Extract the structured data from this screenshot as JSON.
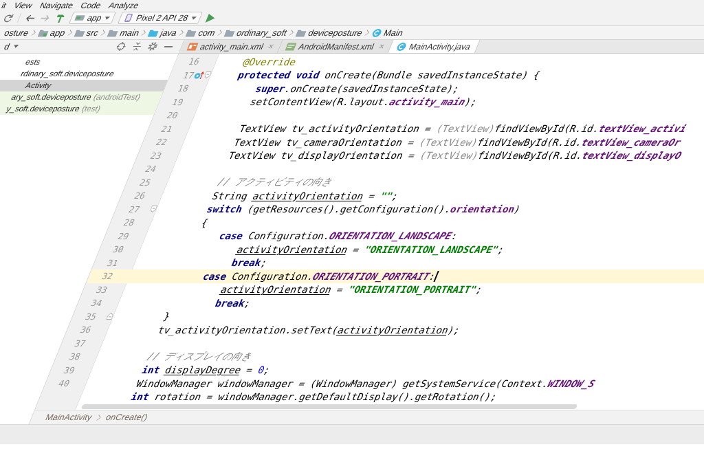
{
  "menu_bar": {
    "items": [
      "it",
      "View",
      "Navigate",
      "Code",
      "Analyze"
    ]
  },
  "toolbar": {
    "configuration": "app",
    "device": "Pixel 2 API 28"
  },
  "navigation_bar": {
    "items": [
      {
        "label": "osture",
        "kind": "plain"
      },
      {
        "label": "app",
        "kind": "module"
      },
      {
        "label": "src",
        "kind": "folder"
      },
      {
        "label": "main",
        "kind": "folder"
      },
      {
        "label": "java",
        "kind": "source"
      },
      {
        "label": "com",
        "kind": "package"
      },
      {
        "label": "ordinary_soft",
        "kind": "package"
      },
      {
        "label": "deviceposture",
        "kind": "package"
      },
      {
        "label": "Main",
        "kind": "class"
      }
    ]
  },
  "project": {
    "view_selector": "d",
    "tree": [
      {
        "label": "ests",
        "kind": "main",
        "selected": false
      },
      {
        "label": "rdinary_soft.deviceposture",
        "kind": "main",
        "selected": false,
        "children": [
          {
            "label": "Activity",
            "kind": "main",
            "selected": true
          }
        ]
      },
      {
        "label": "ary_soft.deviceposture",
        "suffix": "(androidTest)",
        "kind": "test",
        "selected": false
      },
      {
        "label": "y_soft.deviceposture",
        "suffix": "(test)",
        "kind": "test",
        "selected": false
      }
    ]
  },
  "editor_tabs": [
    {
      "label": "activity_main.xml",
      "kind": "layout",
      "selected": false,
      "close_button": true
    },
    {
      "label": "AndroidManifest.xml",
      "kind": "manifest",
      "selected": false,
      "close_button": true
    },
    {
      "label": "MainActivity.java",
      "kind": "class",
      "selected": true,
      "close_button": false
    }
  ],
  "editor": {
    "lines": [
      {
        "number": "16",
        "current": false,
        "tokens": [
          {
            "kind": "annotation",
            "text": "    @Override"
          }
        ]
      },
      {
        "number": "17",
        "current": false,
        "gutter_icons": [
          {
            "kind": "override"
          },
          {
            "kind": "fold_start"
          }
        ],
        "tokens": [
          {
            "kind": "keyword",
            "text": "    protected void"
          },
          {
            "kind": "plain",
            "text": " onCreate(Bundle savedInstanceState) {"
          }
        ]
      },
      {
        "number": "18",
        "current": false,
        "tokens": [
          {
            "kind": "keyword",
            "text": "        super"
          },
          {
            "kind": "plain",
            "text": ".onCreate(savedInstanceState);"
          }
        ]
      },
      {
        "number": "19",
        "current": false,
        "tokens": [
          {
            "kind": "plain",
            "text": "        setContentView(R.layout."
          },
          {
            "kind": "static_field",
            "text": "activity_main"
          },
          {
            "kind": "plain",
            "text": ");"
          }
        ]
      },
      {
        "number": "20",
        "current": false
      },
      {
        "number": "21",
        "current": false,
        "tokens": [
          {
            "kind": "plain",
            "text": "        TextView tv_activityOrientation = "
          },
          {
            "kind": "redundant",
            "text": "(TextView)"
          },
          {
            "kind": "plain",
            "text": "findViewById(R.id."
          },
          {
            "kind": "static_field",
            "text": "textView_activi"
          }
        ]
      },
      {
        "number": "22",
        "current": false,
        "tokens": [
          {
            "kind": "plain",
            "text": "        TextView tv_cameraOrientation = "
          },
          {
            "kind": "redundant",
            "text": "(TextView)"
          },
          {
            "kind": "plain",
            "text": "findViewById(R.id."
          },
          {
            "kind": "static_field",
            "text": "textView_cameraOr"
          }
        ]
      },
      {
        "number": "23",
        "current": false,
        "tokens": [
          {
            "kind": "plain",
            "text": "        TextView tv_displayOrientation = "
          },
          {
            "kind": "redundant",
            "text": "(TextView)"
          },
          {
            "kind": "plain",
            "text": "findViewById(R.id."
          },
          {
            "kind": "static_field",
            "text": "textView_displayO"
          }
        ]
      },
      {
        "number": "24",
        "current": false
      },
      {
        "number": "25",
        "current": false,
        "tokens": [
          {
            "kind": "comment",
            "text": "        // アクティビティの向き"
          }
        ]
      },
      {
        "number": "26",
        "current": false,
        "tokens": [
          {
            "kind": "plain",
            "text": "        String "
          },
          {
            "kind": "reassigned",
            "text": "activityOrientation"
          },
          {
            "kind": "plain",
            "text": " = "
          },
          {
            "kind": "string",
            "text": "\"\""
          },
          {
            "kind": "plain",
            "text": ";"
          }
        ]
      },
      {
        "number": "27",
        "current": false,
        "gutter_icons": [
          {
            "kind": "fold_start"
          }
        ],
        "tokens": [
          {
            "kind": "keyword",
            "text": "        switch"
          },
          {
            "kind": "plain",
            "text": " (getResources().getConfiguration()."
          },
          {
            "kind": "field",
            "text": "orientation"
          },
          {
            "kind": "plain",
            "text": ")"
          }
        ]
      },
      {
        "number": "28",
        "current": false,
        "tokens": [
          {
            "kind": "plain",
            "text": "        {"
          }
        ]
      },
      {
        "number": "29",
        "current": false,
        "tokens": [
          {
            "kind": "keyword",
            "text": "            case"
          },
          {
            "kind": "plain",
            "text": " Configuration."
          },
          {
            "kind": "static_field",
            "text": "ORIENTATION_LANDSCAPE"
          },
          {
            "kind": "plain",
            "text": ":"
          }
        ]
      },
      {
        "number": "30",
        "current": false,
        "tokens": [
          {
            "kind": "reassigned",
            "text": "                activityOrientation"
          },
          {
            "kind": "plain",
            "text": " = "
          },
          {
            "kind": "string",
            "text": "\"ORIENTATION_LANDSCAPE\""
          },
          {
            "kind": "plain",
            "text": ";"
          }
        ]
      },
      {
        "number": "31",
        "current": false,
        "tokens": [
          {
            "kind": "keyword",
            "text": "                break"
          },
          {
            "kind": "plain",
            "text": ";"
          }
        ]
      },
      {
        "number": "32",
        "current": true,
        "tokens": [
          {
            "kind": "keyword",
            "text": "            case"
          },
          {
            "kind": "plain",
            "text": " Configuration."
          },
          {
            "kind": "static_field",
            "text": "ORIENTATION_PORTRAIT"
          },
          {
            "kind": "plain",
            "text": ":"
          }
        ]
      },
      {
        "number": "33",
        "current": false,
        "tokens": [
          {
            "kind": "reassigned",
            "text": "                activityOrientation"
          },
          {
            "kind": "plain",
            "text": " = "
          },
          {
            "kind": "string",
            "text": "\"ORIENTATION_PORTRAIT\""
          },
          {
            "kind": "plain",
            "text": ";"
          }
        ]
      },
      {
        "number": "34",
        "current": false,
        "tokens": [
          {
            "kind": "keyword",
            "text": "                break"
          },
          {
            "kind": "plain",
            "text": ";"
          }
        ]
      },
      {
        "number": "35",
        "current": false,
        "gutter_icons": [
          {
            "kind": "fold_end"
          }
        ],
        "tokens": [
          {
            "kind": "plain",
            "text": "        }"
          }
        ]
      },
      {
        "number": "36",
        "current": false,
        "tokens": [
          {
            "kind": "plain",
            "text": "        tv_activityOrientation.setText("
          },
          {
            "kind": "reassigned",
            "text": "activityOrientation"
          },
          {
            "kind": "plain",
            "text": ");"
          }
        ]
      },
      {
        "number": "37",
        "current": false
      },
      {
        "number": "38",
        "current": false,
        "tokens": [
          {
            "kind": "comment",
            "text": "        // ディスプレイの向き"
          }
        ]
      },
      {
        "number": "39",
        "current": false,
        "tokens": [
          {
            "kind": "keyword",
            "text": "        int "
          },
          {
            "kind": "reassigned",
            "text": "displayDegree"
          },
          {
            "kind": "plain",
            "text": " = "
          },
          {
            "kind": "number",
            "text": "0"
          },
          {
            "kind": "plain",
            "text": ";"
          }
        ]
      },
      {
        "number": "40",
        "current": false,
        "tokens": [
          {
            "kind": "plain",
            "text": "        WindowManager windowManager = (WindowManager) getSystemService(Context."
          },
          {
            "kind": "static_field",
            "text": "WINDOW_S"
          }
        ]
      },
      {
        "current": false,
        "tokens": [
          {
            "kind": "keyword",
            "text": "        int"
          },
          {
            "kind": "plain",
            "text": " rotation = windowManager.getDefaultDisplay().getRotation();"
          }
        ]
      }
    ]
  },
  "breadcrumbs": {
    "items": [
      "MainActivity",
      "onCreate()"
    ]
  }
}
